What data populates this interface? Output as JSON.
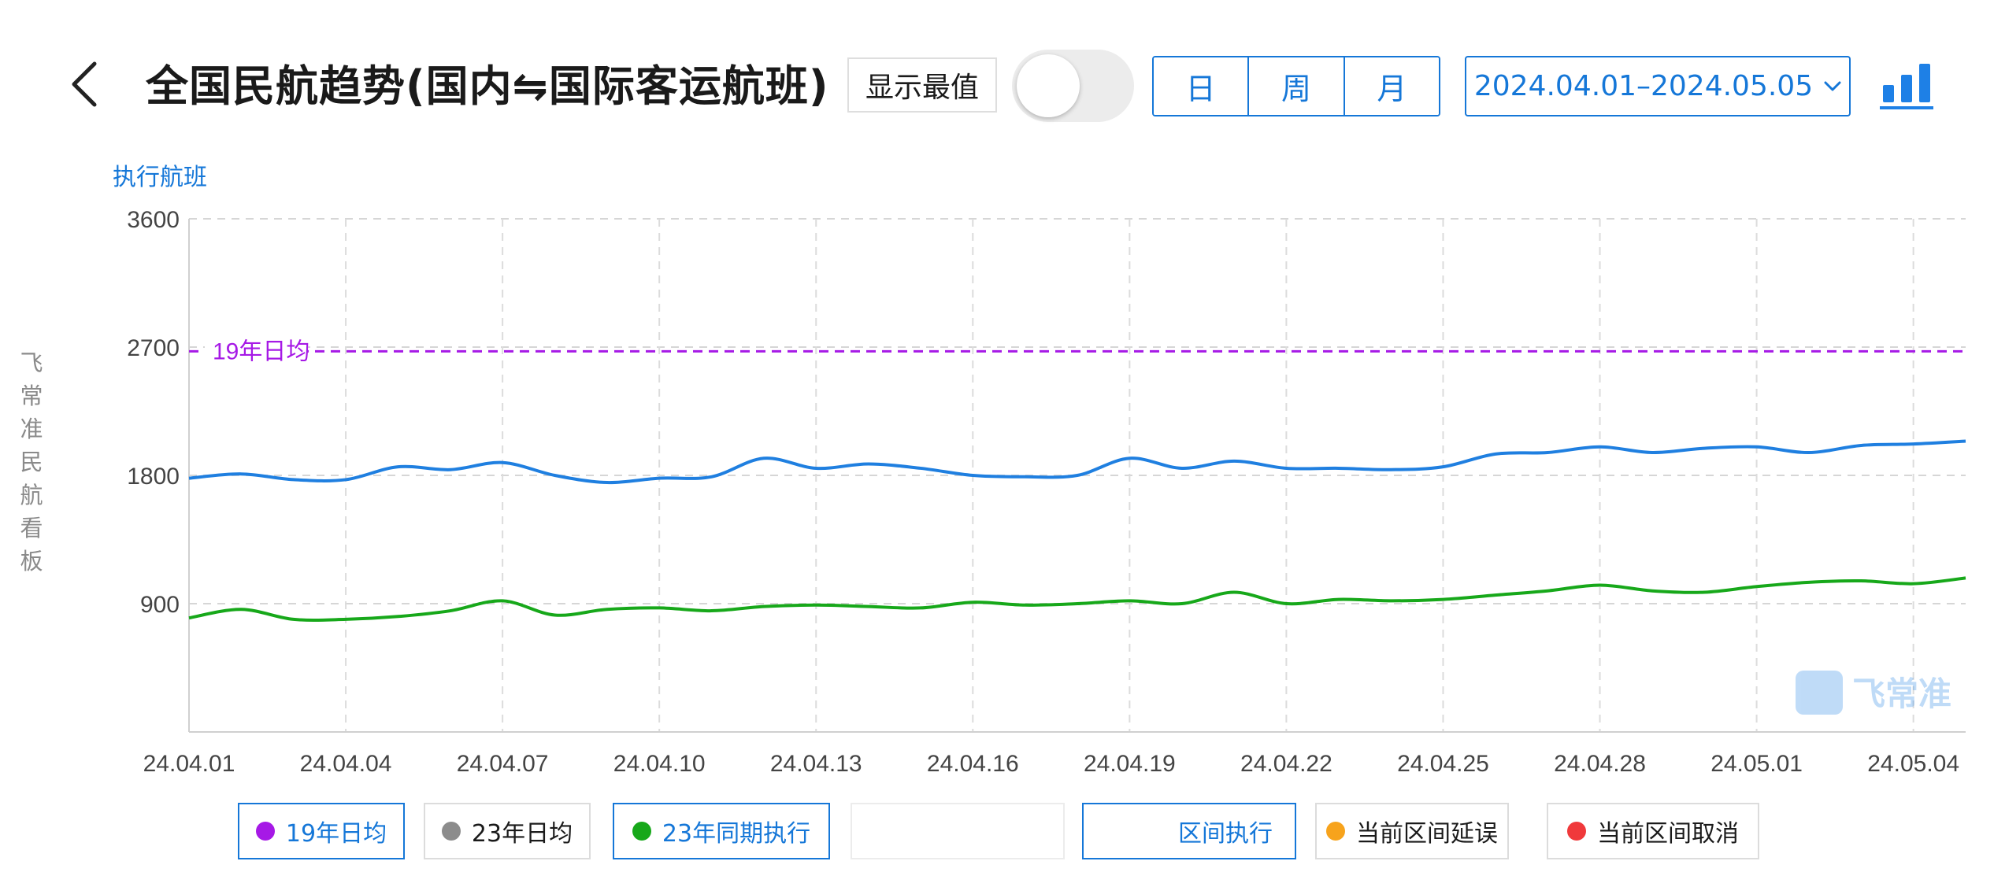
{
  "header": {
    "title": "全国民航趋势(国内⇋国际客运航班)",
    "show_extremes_label": "显示最值",
    "toggle_on": false,
    "period_tabs": [
      {
        "label": "日",
        "state": "active"
      },
      {
        "label": "周",
        "state": "normal"
      },
      {
        "label": "月",
        "state": "disabled"
      }
    ],
    "date_range": "2024.04.01–2024.05.05"
  },
  "side_label": "飞常准民航看板",
  "legend": [
    {
      "label": "19年日均",
      "color": "#a619e6",
      "selected": true
    },
    {
      "label": "23年日均",
      "color": "#8c8c8c",
      "selected": false
    },
    {
      "label": "23年同期执行",
      "color": "#17a81a",
      "selected": true
    },
    {
      "label": "",
      "color": "",
      "selected": false
    },
    {
      "label": "区间执行",
      "color": "",
      "selected": true
    },
    {
      "label": "当前区间延误",
      "color": "#f7a31c",
      "selected": false
    },
    {
      "label": "当前区间取消",
      "color": "#f0393b",
      "selected": false
    }
  ],
  "watermark": "飞常准",
  "chart_data": {
    "type": "line",
    "ylabel": "执行航班",
    "ylim": [
      0,
      3600
    ],
    "yticks": [
      900,
      1800,
      2700,
      3600
    ],
    "grid": true,
    "xtick_labels": [
      "24.04.01",
      "24.04.04",
      "24.04.07",
      "24.04.10",
      "24.04.13",
      "24.04.16",
      "24.04.19",
      "24.04.22",
      "24.04.25",
      "24.04.28",
      "24.05.01",
      "24.05.04"
    ],
    "x": [
      "24.04.01",
      "24.04.02",
      "24.04.03",
      "24.04.04",
      "24.04.05",
      "24.04.06",
      "24.04.07",
      "24.04.08",
      "24.04.09",
      "24.04.10",
      "24.04.11",
      "24.04.12",
      "24.04.13",
      "24.04.14",
      "24.04.15",
      "24.04.16",
      "24.04.17",
      "24.04.18",
      "24.04.19",
      "24.04.20",
      "24.04.21",
      "24.04.22",
      "24.04.23",
      "24.04.24",
      "24.04.25",
      "24.04.26",
      "24.04.27",
      "24.04.28",
      "24.04.29",
      "24.04.30",
      "24.05.01",
      "24.05.02",
      "24.05.03",
      "24.05.04",
      "24.05.05"
    ],
    "reference_lines": [
      {
        "label": "19年日均",
        "value": 2670,
        "color": "#a619e6",
        "dashed": true
      }
    ],
    "series": [
      {
        "color": "#1f7fe0",
        "values": [
          1780,
          1810,
          1770,
          1770,
          1860,
          1840,
          1890,
          1800,
          1750,
          1780,
          1790,
          1920,
          1850,
          1880,
          1850,
          1800,
          1790,
          1800,
          1920,
          1850,
          1900,
          1850,
          1850,
          1840,
          1860,
          1950,
          1960,
          2000,
          1960,
          1990,
          2000,
          1960,
          2010,
          2020,
          2040
        ]
      },
      {
        "name": "23年同期执行",
        "color": "#17a81a",
        "values": [
          800,
          860,
          790,
          790,
          810,
          850,
          920,
          820,
          860,
          870,
          850,
          880,
          890,
          880,
          870,
          910,
          890,
          900,
          920,
          900,
          980,
          900,
          930,
          920,
          930,
          960,
          990,
          1030,
          990,
          980,
          1020,
          1050,
          1060,
          1040,
          1080
        ]
      }
    ]
  }
}
